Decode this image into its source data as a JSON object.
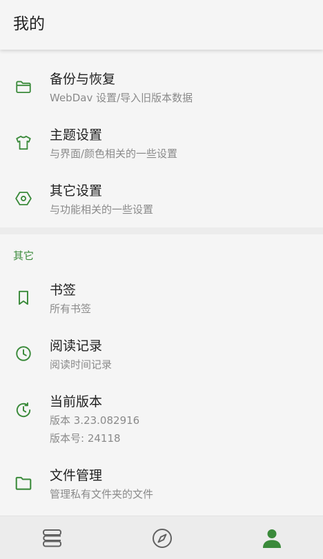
{
  "header": {
    "title": "我的"
  },
  "colors": {
    "accent": "#3a8a3a",
    "icon_gray": "#616161",
    "text_primary": "#212121",
    "text_secondary": "#8a8a8a"
  },
  "settings": [
    {
      "icon": "folder-outline-icon",
      "title": "备份与恢复",
      "subtitle": "WebDav 设置/导入旧版本数据"
    },
    {
      "icon": "tshirt-icon",
      "title": "主题设置",
      "subtitle": "与界面/颜色相关的一些设置"
    },
    {
      "icon": "hexagon-settings-icon",
      "title": "其它设置",
      "subtitle": "与功能相关的一些设置"
    }
  ],
  "other": {
    "section_title": "其它",
    "items": [
      {
        "icon": "bookmark-icon",
        "title": "书签",
        "subtitle": "所有书签"
      },
      {
        "icon": "clock-icon",
        "title": "阅读记录",
        "subtitle": "阅读时间记录"
      },
      {
        "icon": "update-clock-icon",
        "title": "当前版本",
        "subtitle": "版本 3.23.082916",
        "subtitle2": "版本号: 24118"
      },
      {
        "icon": "folder-filled-icon",
        "title": "文件管理",
        "subtitle": "管理私有文件夹的文件"
      }
    ]
  },
  "bottom_nav": [
    {
      "icon": "bookshelf-icon",
      "active": false
    },
    {
      "icon": "compass-icon",
      "active": false
    },
    {
      "icon": "person-icon",
      "active": true
    }
  ]
}
